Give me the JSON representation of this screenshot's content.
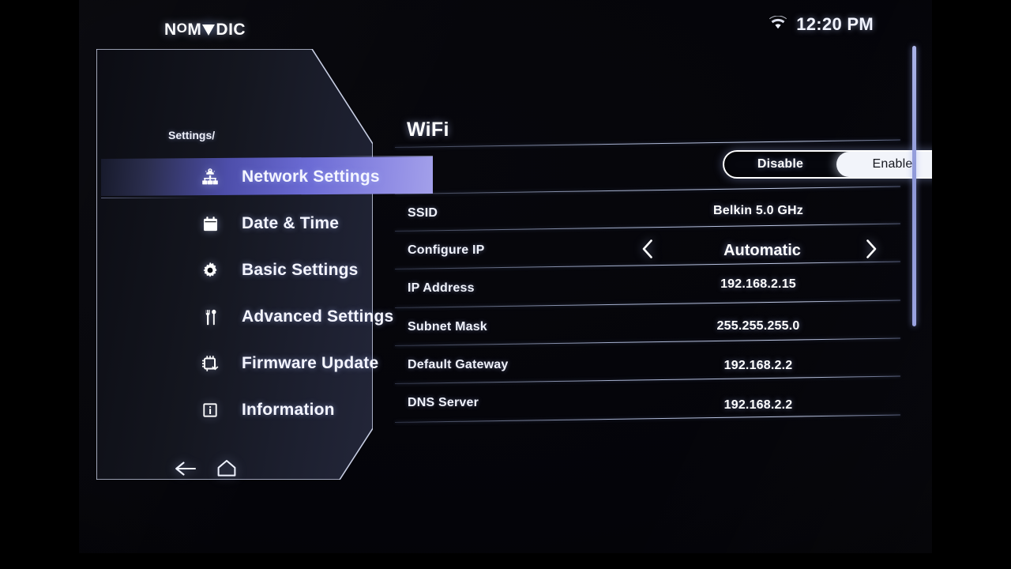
{
  "statusbar": {
    "wifi_icon": "wifi-icon",
    "time": "12:20 PM"
  },
  "sidebar": {
    "logo": {
      "part1": "N",
      "part2": "O",
      "part3": "M",
      "triangle": "triangle-a-glyph",
      "part4": "DIC",
      "full_text": "NOMVDIC"
    },
    "breadcrumb": "Settings/",
    "items": [
      {
        "label": "Network Settings",
        "icon": "network-icon",
        "selected": true
      },
      {
        "label": "Date & Time",
        "icon": "calendar-icon",
        "selected": false
      },
      {
        "label": "Basic Settings",
        "icon": "gear-icon",
        "selected": false
      },
      {
        "label": "Advanced Settings",
        "icon": "tools-icon",
        "selected": false
      },
      {
        "label": "Firmware Update",
        "icon": "chip-download-icon",
        "selected": false
      },
      {
        "label": "Information",
        "icon": "info-icon",
        "selected": false
      }
    ],
    "bottom_nav": [
      {
        "name": "back-button",
        "icon": "arrow-left-icon"
      },
      {
        "name": "home-button",
        "icon": "home-icon"
      }
    ]
  },
  "main": {
    "title": "WiFi",
    "toggle": {
      "options": [
        "Disable",
        "Enable"
      ],
      "disable_label": "Disable",
      "enable_label": "Enable",
      "selected": "Enable"
    },
    "rows": [
      {
        "label": "SSID",
        "value": "Belkin 5.0 GHz",
        "type": "text"
      },
      {
        "label": "Configure IP",
        "value": "Automatic",
        "type": "stepper"
      },
      {
        "label": "IP Address",
        "value": "192.168.2.15",
        "type": "text"
      },
      {
        "label": "Subnet Mask",
        "value": "255.255.255.0",
        "type": "text"
      },
      {
        "label": "Default Gateway",
        "value": "192.168.2.2",
        "type": "text"
      },
      {
        "label": "DNS Server",
        "value": "192.168.2.2",
        "type": "text"
      }
    ]
  },
  "colors": {
    "accent_highlight_start": "#2b2e4e",
    "accent_highlight_end": "#a3a0ea",
    "panel_bg": "#14161f",
    "screen_bg": "#040409",
    "text_primary": "#ffffff",
    "divider": "#cddaff",
    "scrollbar": "#9aa3e0"
  }
}
